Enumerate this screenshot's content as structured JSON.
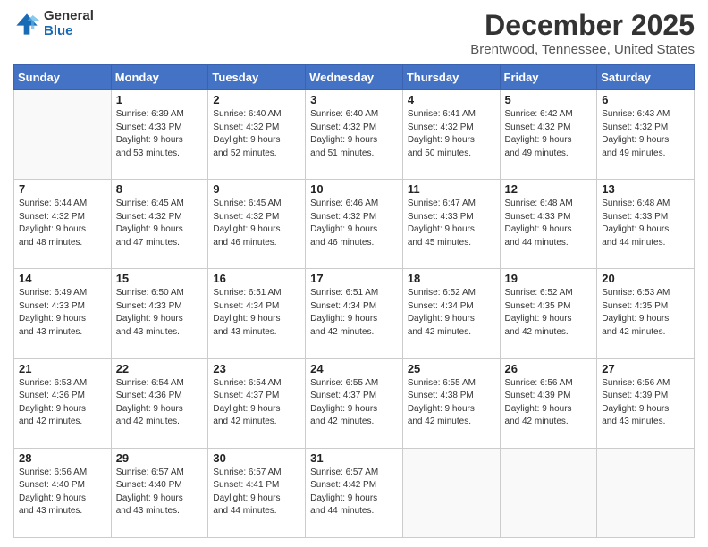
{
  "logo": {
    "general": "General",
    "blue": "Blue"
  },
  "title": {
    "month": "December 2025",
    "location": "Brentwood, Tennessee, United States"
  },
  "days_of_week": [
    "Sunday",
    "Monday",
    "Tuesday",
    "Wednesday",
    "Thursday",
    "Friday",
    "Saturday"
  ],
  "weeks": [
    [
      {
        "day": null
      },
      {
        "day": 1,
        "sunrise": "6:39 AM",
        "sunset": "4:33 PM",
        "daylight": "9 hours and 53 minutes."
      },
      {
        "day": 2,
        "sunrise": "6:40 AM",
        "sunset": "4:32 PM",
        "daylight": "9 hours and 52 minutes."
      },
      {
        "day": 3,
        "sunrise": "6:40 AM",
        "sunset": "4:32 PM",
        "daylight": "9 hours and 51 minutes."
      },
      {
        "day": 4,
        "sunrise": "6:41 AM",
        "sunset": "4:32 PM",
        "daylight": "9 hours and 50 minutes."
      },
      {
        "day": 5,
        "sunrise": "6:42 AM",
        "sunset": "4:32 PM",
        "daylight": "9 hours and 49 minutes."
      },
      {
        "day": 6,
        "sunrise": "6:43 AM",
        "sunset": "4:32 PM",
        "daylight": "9 hours and 49 minutes."
      }
    ],
    [
      {
        "day": 7,
        "sunrise": "6:44 AM",
        "sunset": "4:32 PM",
        "daylight": "9 hours and 48 minutes."
      },
      {
        "day": 8,
        "sunrise": "6:45 AM",
        "sunset": "4:32 PM",
        "daylight": "9 hours and 47 minutes."
      },
      {
        "day": 9,
        "sunrise": "6:45 AM",
        "sunset": "4:32 PM",
        "daylight": "9 hours and 46 minutes."
      },
      {
        "day": 10,
        "sunrise": "6:46 AM",
        "sunset": "4:32 PM",
        "daylight": "9 hours and 46 minutes."
      },
      {
        "day": 11,
        "sunrise": "6:47 AM",
        "sunset": "4:33 PM",
        "daylight": "9 hours and 45 minutes."
      },
      {
        "day": 12,
        "sunrise": "6:48 AM",
        "sunset": "4:33 PM",
        "daylight": "9 hours and 44 minutes."
      },
      {
        "day": 13,
        "sunrise": "6:48 AM",
        "sunset": "4:33 PM",
        "daylight": "9 hours and 44 minutes."
      }
    ],
    [
      {
        "day": 14,
        "sunrise": "6:49 AM",
        "sunset": "4:33 PM",
        "daylight": "9 hours and 43 minutes."
      },
      {
        "day": 15,
        "sunrise": "6:50 AM",
        "sunset": "4:33 PM",
        "daylight": "9 hours and 43 minutes."
      },
      {
        "day": 16,
        "sunrise": "6:51 AM",
        "sunset": "4:34 PM",
        "daylight": "9 hours and 43 minutes."
      },
      {
        "day": 17,
        "sunrise": "6:51 AM",
        "sunset": "4:34 PM",
        "daylight": "9 hours and 42 minutes."
      },
      {
        "day": 18,
        "sunrise": "6:52 AM",
        "sunset": "4:34 PM",
        "daylight": "9 hours and 42 minutes."
      },
      {
        "day": 19,
        "sunrise": "6:52 AM",
        "sunset": "4:35 PM",
        "daylight": "9 hours and 42 minutes."
      },
      {
        "day": 20,
        "sunrise": "6:53 AM",
        "sunset": "4:35 PM",
        "daylight": "9 hours and 42 minutes."
      }
    ],
    [
      {
        "day": 21,
        "sunrise": "6:53 AM",
        "sunset": "4:36 PM",
        "daylight": "9 hours and 42 minutes."
      },
      {
        "day": 22,
        "sunrise": "6:54 AM",
        "sunset": "4:36 PM",
        "daylight": "9 hours and 42 minutes."
      },
      {
        "day": 23,
        "sunrise": "6:54 AM",
        "sunset": "4:37 PM",
        "daylight": "9 hours and 42 minutes."
      },
      {
        "day": 24,
        "sunrise": "6:55 AM",
        "sunset": "4:37 PM",
        "daylight": "9 hours and 42 minutes."
      },
      {
        "day": 25,
        "sunrise": "6:55 AM",
        "sunset": "4:38 PM",
        "daylight": "9 hours and 42 minutes."
      },
      {
        "day": 26,
        "sunrise": "6:56 AM",
        "sunset": "4:39 PM",
        "daylight": "9 hours and 42 minutes."
      },
      {
        "day": 27,
        "sunrise": "6:56 AM",
        "sunset": "4:39 PM",
        "daylight": "9 hours and 43 minutes."
      }
    ],
    [
      {
        "day": 28,
        "sunrise": "6:56 AM",
        "sunset": "4:40 PM",
        "daylight": "9 hours and 43 minutes."
      },
      {
        "day": 29,
        "sunrise": "6:57 AM",
        "sunset": "4:40 PM",
        "daylight": "9 hours and 43 minutes."
      },
      {
        "day": 30,
        "sunrise": "6:57 AM",
        "sunset": "4:41 PM",
        "daylight": "9 hours and 44 minutes."
      },
      {
        "day": 31,
        "sunrise": "6:57 AM",
        "sunset": "4:42 PM",
        "daylight": "9 hours and 44 minutes."
      },
      {
        "day": null
      },
      {
        "day": null
      },
      {
        "day": null
      }
    ]
  ],
  "labels": {
    "sunrise": "Sunrise:",
    "sunset": "Sunset:",
    "daylight": "Daylight:"
  }
}
